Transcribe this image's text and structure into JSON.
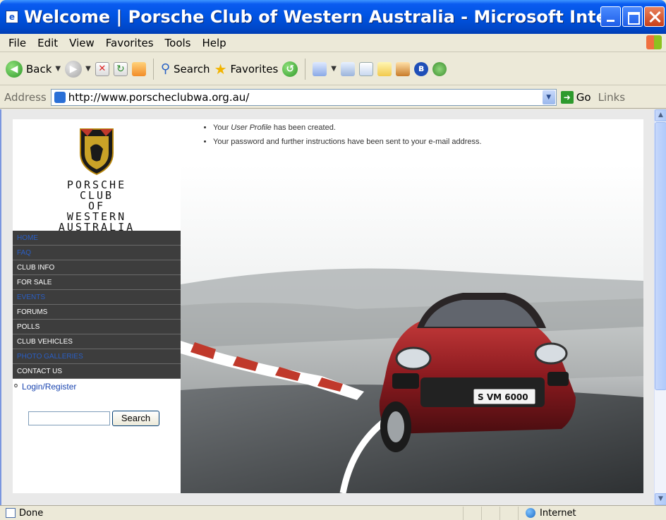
{
  "window": {
    "title": "Welcome | Porsche Club of Western Australia - Microsoft Internet E..."
  },
  "menu": [
    "File",
    "Edit",
    "View",
    "Favorites",
    "Tools",
    "Help"
  ],
  "toolbar": {
    "back_label": "Back",
    "search_label": "Search",
    "favorites_label": "Favorites"
  },
  "address": {
    "label": "Address",
    "url": "http://www.porscheclubwa.org.au/",
    "go_label": "Go",
    "links_label": "Links"
  },
  "site": {
    "logo_lines": [
      "PORSCHE",
      "CLUB",
      "OF",
      "WESTERN",
      "AUSTRALIA"
    ],
    "nav": [
      {
        "label": "HOME",
        "dim": true
      },
      {
        "label": "FAQ",
        "dim": true
      },
      {
        "label": "CLUB INFO",
        "dim": false
      },
      {
        "label": "FOR SALE",
        "dim": false
      },
      {
        "label": "EVENTS",
        "dim": true
      },
      {
        "label": "FORUMS",
        "dim": false
      },
      {
        "label": "POLLS",
        "dim": false
      },
      {
        "label": "CLUB VEHICLES",
        "dim": false
      },
      {
        "label": "PHOTO GALLERIES",
        "dim": true
      },
      {
        "label": "CONTACT US",
        "dim": false
      }
    ],
    "login_label": "Login/Register",
    "search_button": "Search",
    "messages": {
      "msg1_pre": "Your ",
      "msg1_em": "User Profile",
      "msg1_post": " has been created.",
      "msg2": "Your password and further instructions have been sent to your e-mail address."
    },
    "hero_plate": "S VM 6000"
  },
  "status": {
    "text": "Done",
    "zone": "Internet"
  },
  "colors": {
    "nav_bg": "#3d3d3d",
    "nav_dim_text": "#2a5ec4",
    "titlebar_blue": "#0054e3",
    "car_red": "#8b1a1f"
  }
}
